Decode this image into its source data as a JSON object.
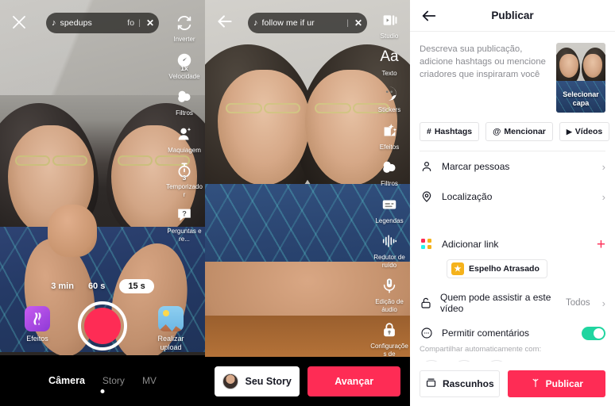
{
  "panel1": {
    "close_icon": "close-icon",
    "music": {
      "text": "spedups",
      "trailing": "fo",
      "note_icon": "music-note-icon",
      "clear_icon": "close-icon"
    },
    "rail": [
      {
        "label": "Inverter",
        "icon": "flip-camera-icon"
      },
      {
        "label": "Velocidade",
        "icon": "speed-icon",
        "badge": "1x"
      },
      {
        "label": "Filtros",
        "icon": "filters-icon"
      },
      {
        "label": "Maquiagem",
        "icon": "makeup-icon"
      },
      {
        "label": "Temporizador",
        "icon": "timer-icon",
        "badge": "3"
      },
      {
        "label": "Perguntas e re...",
        "icon": "question-icon"
      }
    ],
    "durations": [
      {
        "label": "3 min",
        "selected": false
      },
      {
        "label": "60 s",
        "selected": false
      },
      {
        "label": "15 s",
        "selected": true
      }
    ],
    "record_button": "record-button",
    "effects": {
      "label": "Efeitos",
      "icon": "effects-icon"
    },
    "upload": {
      "label": "Realizar upload",
      "icon": "gallery-icon"
    },
    "tabs": [
      {
        "label": "Câmera",
        "active": true
      },
      {
        "label": "Story",
        "active": false
      },
      {
        "label": "MV",
        "active": false
      }
    ]
  },
  "panel2": {
    "back_icon": "back-arrow-icon",
    "music": {
      "text": "follow me if ur",
      "note_icon": "music-note-icon",
      "clear_icon": "close-icon"
    },
    "rail": [
      {
        "label": "Studio",
        "icon": "studio-icon"
      },
      {
        "label": "Texto",
        "icon": "text-icon",
        "glyph": "Aa"
      },
      {
        "label": "Stickers",
        "icon": "sticker-icon"
      },
      {
        "label": "Efeitos",
        "icon": "effects-sparkle-icon"
      },
      {
        "label": "Filtros",
        "icon": "filters-icon"
      },
      {
        "label": "Legendas",
        "icon": "captions-icon"
      },
      {
        "label": "Redutor de ruído",
        "icon": "noise-reduction-icon"
      },
      {
        "label": "Edição de áudio",
        "icon": "audio-edit-icon"
      },
      {
        "label": "Configurações de privacidade",
        "icon": "lock-icon"
      }
    ],
    "story_button": "Seu Story",
    "next_button": "Avançar"
  },
  "panel3": {
    "title": "Publicar",
    "back_icon": "back-arrow-icon",
    "description_placeholder": "Descreva sua publicação, adicione hashtags ou mencione criadores que inspiraram você",
    "cover": {
      "label": "Selecionar capa"
    },
    "chips": [
      {
        "label": "Hashtags",
        "icon": "hash-icon",
        "glyph": "#"
      },
      {
        "label": "Mencionar",
        "icon": "at-icon",
        "glyph": "@"
      },
      {
        "label": "Vídeos",
        "icon": "video-play-icon",
        "glyph": "▶"
      }
    ],
    "rows": [
      {
        "label": "Marcar pessoas",
        "icon": "person-icon",
        "value": "",
        "chevron": "›"
      },
      {
        "label": "Localização",
        "icon": "location-pin-icon",
        "value": "",
        "chevron": "›"
      }
    ],
    "add_link": {
      "label": "Adicionar link",
      "icon": "apps-dots-icon",
      "plus": "+"
    },
    "link_tag": {
      "label": "Espelho Atrasado",
      "icon": "app-badge-icon"
    },
    "privacy": {
      "label": "Quem pode assistir a este vídeo",
      "icon": "unlock-icon",
      "value": "Todos",
      "chevron": "›"
    },
    "comments": {
      "label": "Permitir comentários",
      "icon": "comment-icon",
      "enabled": true
    },
    "share_label": "Compartilhar automaticamente com:",
    "share_icons": [
      {
        "name": "whatsapp-icon"
      },
      {
        "name": "instagram-icon"
      },
      {
        "name": "more-share-icon"
      }
    ],
    "drafts_button": {
      "label": "Rascunhos",
      "icon": "drafts-icon"
    },
    "publish_button": {
      "label": "Publicar",
      "icon": "publish-sparkle-icon"
    }
  },
  "colors": {
    "accent_red": "#fe2c55",
    "toggle_green": "#20d5a0",
    "white": "#ffffff",
    "black": "#000000",
    "muted_text": "#8a8b91"
  }
}
